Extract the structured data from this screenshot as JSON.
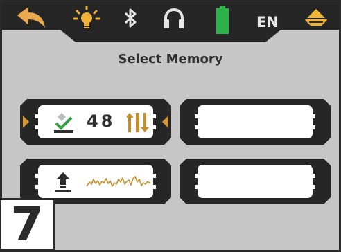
{
  "screen": {
    "title": "Select Memory",
    "language": "EN"
  },
  "top_bar": {
    "icons": [
      "back-arrow-icon",
      "light-bulb-icon",
      "bluetooth-icon",
      "headphones-icon",
      "battery-icon",
      "language-label",
      "menu-pyramid-icon"
    ],
    "battery_level": 1.0,
    "colors": {
      "back": "#e9a94f",
      "bulb": "#f0b43a",
      "battery": "#2db34a",
      "pyramid": "#f0b43a",
      "bar": "#262626"
    }
  },
  "memory_slots": [
    {
      "id": "slot-1",
      "state": "selected",
      "icon": "download-check-icon",
      "count": "48",
      "action_icon": "sort-arrows-icon"
    },
    {
      "id": "slot-2",
      "state": "empty"
    },
    {
      "id": "slot-3",
      "state": "saved-signal",
      "icon": "upload-icon",
      "has_waveform": true
    },
    {
      "id": "slot-4",
      "state": "empty"
    }
  ],
  "badge": {
    "number": "7"
  }
}
